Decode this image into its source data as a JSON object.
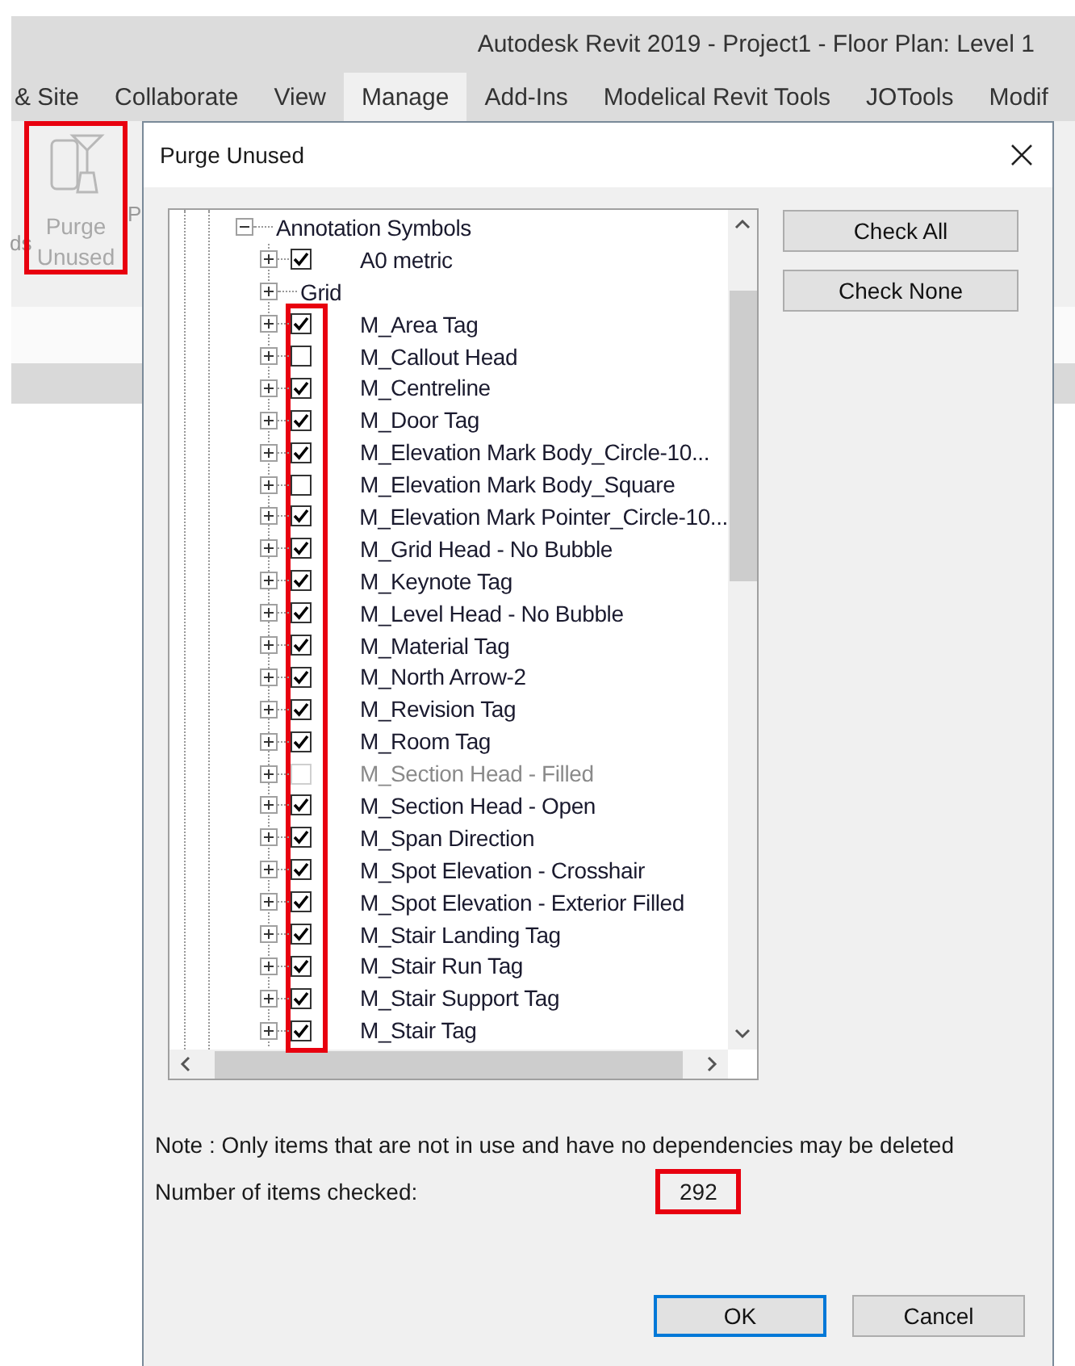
{
  "app": {
    "title": "Autodesk Revit 2019 - Project1 - Floor Plan: Level 1",
    "tabs": [
      {
        "label": "& Site",
        "selected": false
      },
      {
        "label": "Collaborate",
        "selected": false
      },
      {
        "label": "View",
        "selected": false
      },
      {
        "label": "Manage",
        "selected": true
      },
      {
        "label": "Add-Ins",
        "selected": false
      },
      {
        "label": "Modelical Revit Tools",
        "selected": false
      },
      {
        "label": "JOTools",
        "selected": false
      },
      {
        "label": "Modif",
        "selected": false
      }
    ],
    "ribbon": {
      "fragment_left": "ds",
      "purge_button": {
        "label": "Purge Unused",
        "disabled": true,
        "highlighted": true
      },
      "fragment_right": "P"
    }
  },
  "dialog": {
    "title": "Purge Unused",
    "tree": [
      {
        "label": "Annotation Symbols",
        "expanded": true,
        "checkbox_column_highlighted": true,
        "children": [
          {
            "kind": "item",
            "label": "A0 metric",
            "checked": true,
            "disabled": false,
            "expanded": false
          },
          {
            "kind": "folder",
            "label": "Grid",
            "expanded": false
          },
          {
            "kind": "item",
            "label": "M_Area Tag",
            "checked": true,
            "disabled": false,
            "expanded": false
          },
          {
            "kind": "item",
            "label": "M_Callout Head",
            "checked": false,
            "disabled": false,
            "expanded": false
          },
          {
            "kind": "item",
            "label": "M_Centreline",
            "checked": true,
            "disabled": false,
            "expanded": false
          },
          {
            "kind": "item",
            "label": "M_Door Tag",
            "checked": true,
            "disabled": false,
            "expanded": false
          },
          {
            "kind": "item",
            "label": "M_Elevation Mark Body_Circle-10...",
            "checked": true,
            "disabled": false,
            "expanded": false
          },
          {
            "kind": "item",
            "label": "M_Elevation Mark Body_Square",
            "checked": false,
            "disabled": false,
            "expanded": false
          },
          {
            "kind": "item",
            "label": "M_Elevation Mark Pointer_Circle-10...",
            "checked": true,
            "disabled": false,
            "expanded": false
          },
          {
            "kind": "item",
            "label": "M_Grid Head - No Bubble",
            "checked": true,
            "disabled": false,
            "expanded": false
          },
          {
            "kind": "item",
            "label": "M_Keynote Tag",
            "checked": true,
            "disabled": false,
            "expanded": false
          },
          {
            "kind": "item",
            "label": "M_Level Head - No Bubble",
            "checked": true,
            "disabled": false,
            "expanded": false
          },
          {
            "kind": "item",
            "label": "M_Material Tag",
            "checked": true,
            "disabled": false,
            "expanded": false
          },
          {
            "kind": "item",
            "label": "M_North Arrow-2",
            "checked": true,
            "disabled": false,
            "expanded": false
          },
          {
            "kind": "item",
            "label": "M_Revision Tag",
            "checked": true,
            "disabled": false,
            "expanded": false
          },
          {
            "kind": "item",
            "label": "M_Room Tag",
            "checked": true,
            "disabled": false,
            "expanded": false
          },
          {
            "kind": "item",
            "label": "M_Section Head - Filled",
            "checked": false,
            "disabled": true,
            "expanded": false
          },
          {
            "kind": "item",
            "label": "M_Section Head - Open",
            "checked": true,
            "disabled": false,
            "expanded": false
          },
          {
            "kind": "item",
            "label": "M_Span Direction",
            "checked": true,
            "disabled": false,
            "expanded": false
          },
          {
            "kind": "item",
            "label": "M_Spot Elevation - Crosshair",
            "checked": true,
            "disabled": false,
            "expanded": false
          },
          {
            "kind": "item",
            "label": "M_Spot Elevation - Exterior Filled",
            "checked": true,
            "disabled": false,
            "expanded": false
          },
          {
            "kind": "item",
            "label": "M_Stair Landing Tag",
            "checked": true,
            "disabled": false,
            "expanded": false
          },
          {
            "kind": "item",
            "label": "M_Stair Run Tag",
            "checked": true,
            "disabled": false,
            "expanded": false
          },
          {
            "kind": "item",
            "label": "M_Stair Support Tag",
            "checked": true,
            "disabled": false,
            "expanded": false
          },
          {
            "kind": "item",
            "label": "M_Stair Tag",
            "checked": true,
            "disabled": false,
            "expanded": false
          }
        ]
      }
    ],
    "side_buttons": [
      "Check All",
      "Check None"
    ],
    "note": "Note : Only items that are not in use and have no dependencies may be deleted",
    "count_label": "Number of items checked:",
    "count": "292",
    "count_highlighted": true,
    "buttons": [
      {
        "label": "OK",
        "default": true
      },
      {
        "label": "Cancel",
        "default": false
      }
    ]
  }
}
